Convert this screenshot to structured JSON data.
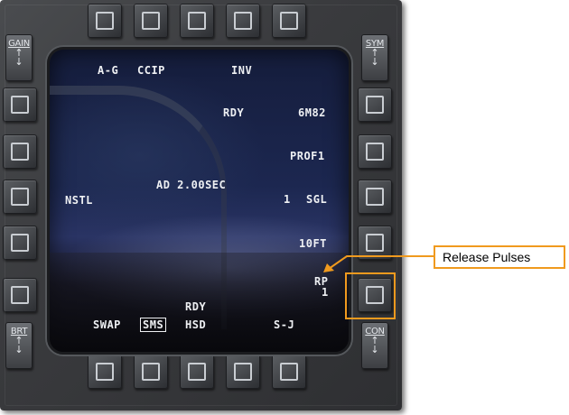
{
  "mfd": {
    "rockers": {
      "gain": "GAIN",
      "sym": "SYM",
      "brt": "BRT",
      "con": "CON"
    },
    "labels": {
      "ag": "A-G",
      "ccip": "CCIP",
      "inv": "INV",
      "rdy_top": "RDY",
      "gm82": "6M82",
      "prof1": "PROF1",
      "ad": "AD 2.00SEC",
      "nstl": "NSTL",
      "sgl_num": "1",
      "sgl": "SGL",
      "ft": "10FT",
      "rp": "RP",
      "rp_val": "1",
      "rdy_bottom": "RDY",
      "swap": "SWAP",
      "sms": "SMS",
      "hsd": "HSD",
      "sj": "S-J"
    }
  },
  "annotation": {
    "callout": "Release Pulses",
    "accent_color": "#f09a1e"
  }
}
